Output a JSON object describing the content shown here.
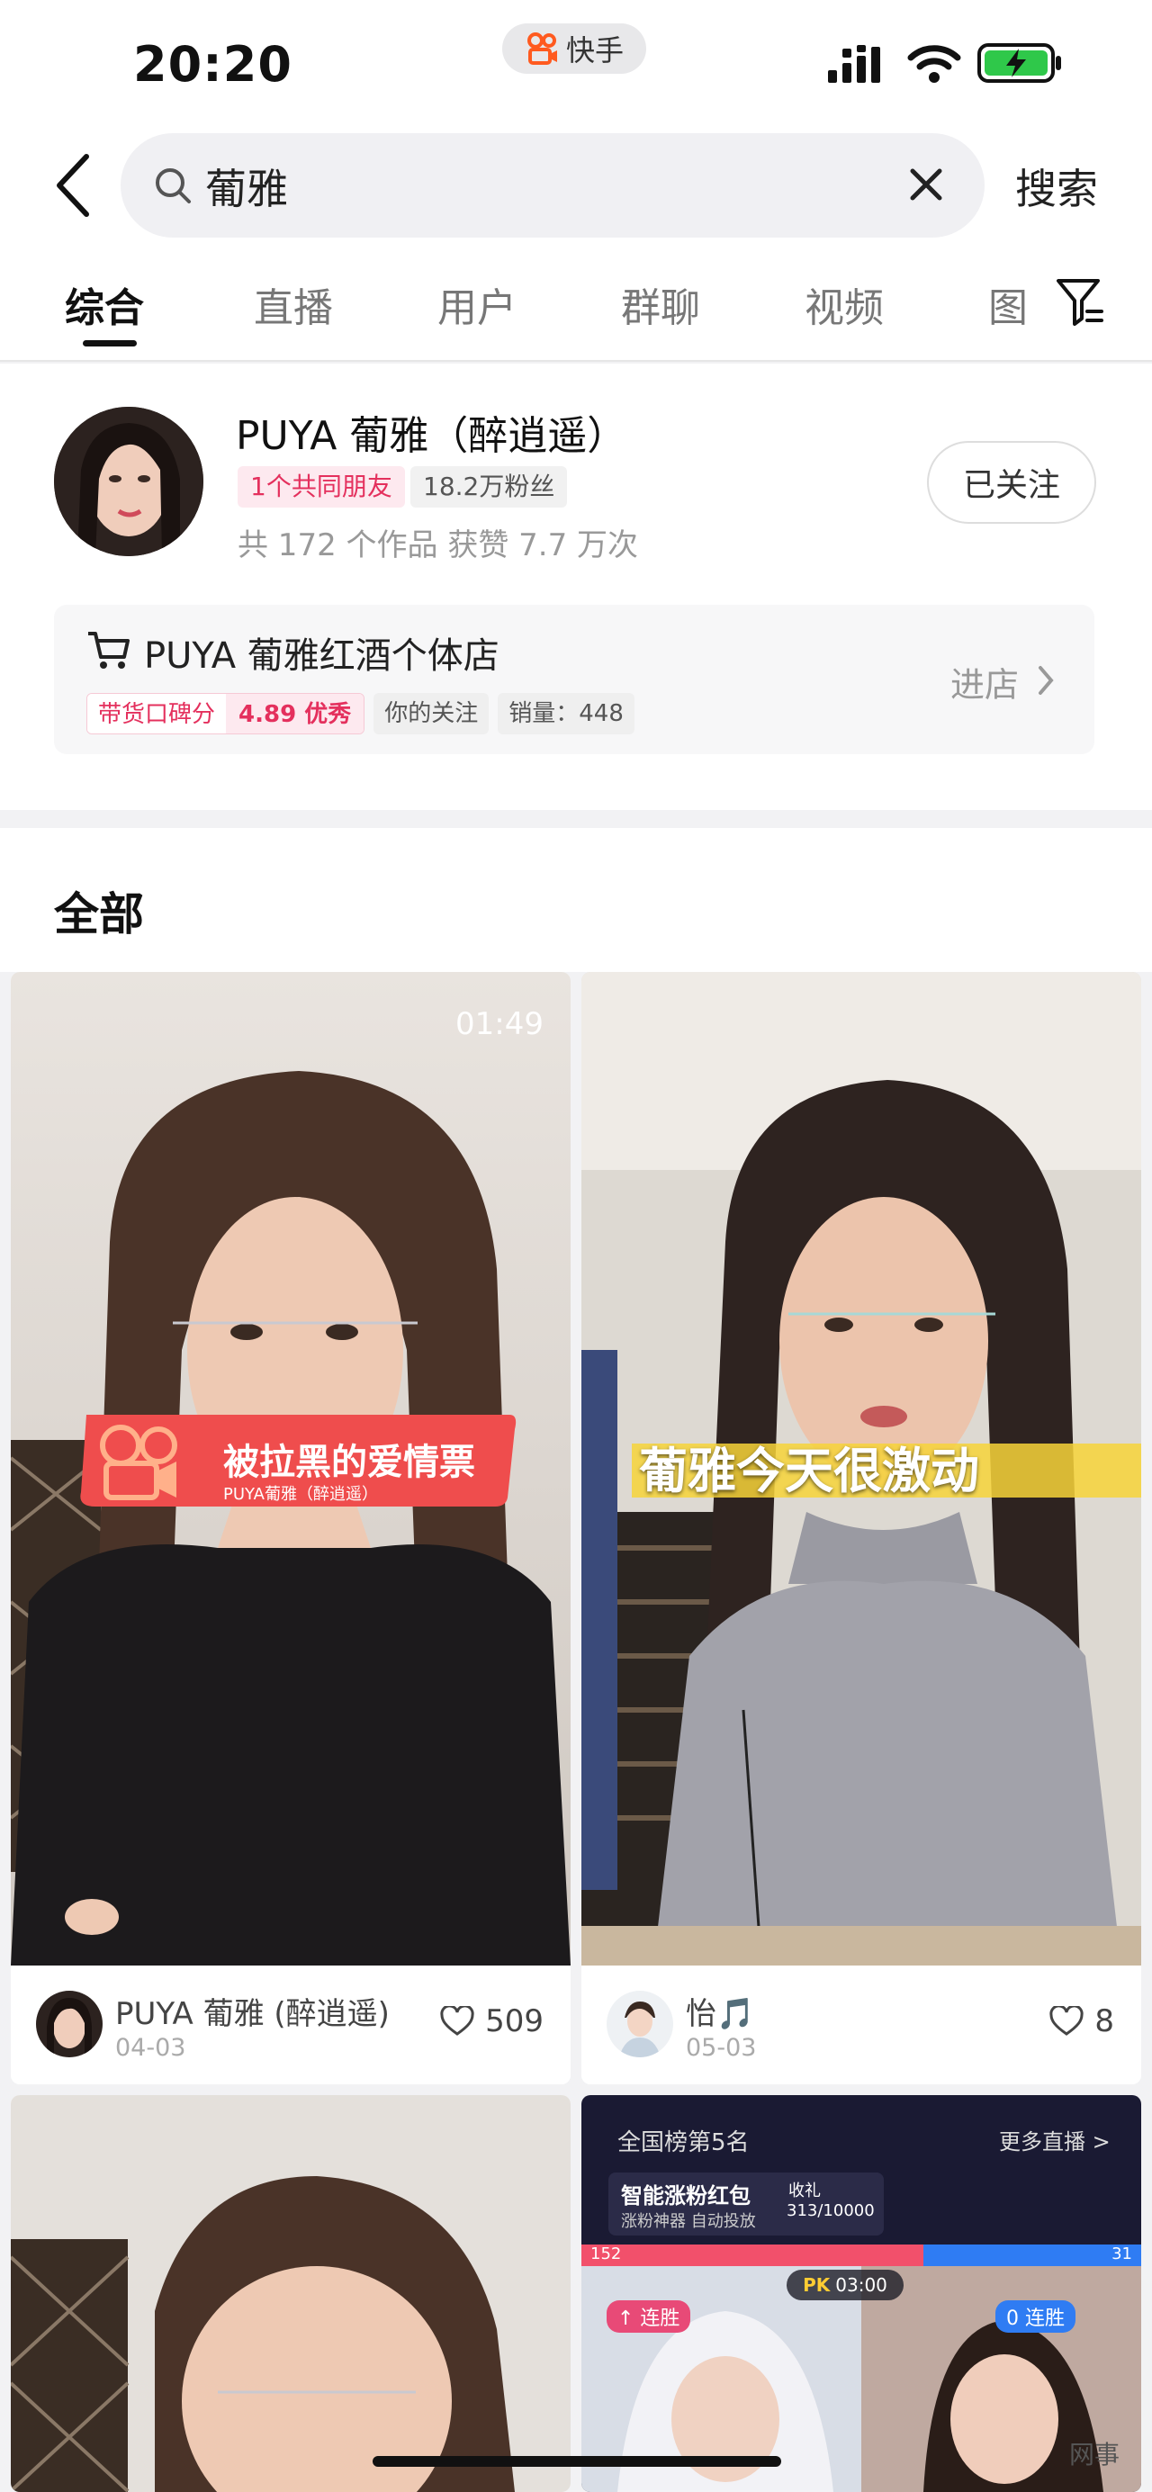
{
  "status_bar": {
    "time": "20:20",
    "app_name": "快手"
  },
  "search": {
    "query": "葡雅",
    "submit_label": "搜索"
  },
  "tabs": [
    "综合",
    "直播",
    "用户",
    "群聊",
    "视频",
    "图"
  ],
  "profile": {
    "name": "PUYA 葡雅（醉逍遥）",
    "mutual_friends": "1个共同朋友",
    "fans": "18.2万粉丝",
    "stats": "共 172 个作品  获赞 7.7 万次",
    "follow_label": "已关注"
  },
  "shop": {
    "name": "PUYA 葡雅红酒个体店",
    "score_label": "带货口碑分",
    "score_value": "4.89 优秀",
    "badge_following": "你的关注",
    "badge_sales": "销量：448",
    "enter_label": "进店"
  },
  "section": {
    "title": "全部"
  },
  "videos": [
    {
      "duration": "01:49",
      "banner_title": "被拉黑的爱情票",
      "banner_sub": "PUYA葡雅（醉逍遥）",
      "author": "PUYA 葡雅 (醉逍遥)",
      "date": "04-03",
      "likes": "509"
    },
    {
      "caption": "葡雅今天很激动",
      "author": "怡🎵",
      "date": "05-03",
      "likes": "8"
    },
    {},
    {
      "rank": "全国榜第5名",
      "more_live": "更多直播 >",
      "promo_title": "智能涨粉红包",
      "promo_sub": "涨粉神器 自动投放",
      "income_label": "收礼",
      "income_value": "313/10000",
      "pk_left": "152",
      "pk_right": "31",
      "pk_timer": "03:00",
      "win_left": "↑ 连胜",
      "win_right": "0 连胜"
    }
  ],
  "watermark": "网事",
  "colors": {
    "accent_pink": "#e4305d",
    "pk_red": "#f2506b",
    "pk_blue": "#2f7cf3"
  }
}
